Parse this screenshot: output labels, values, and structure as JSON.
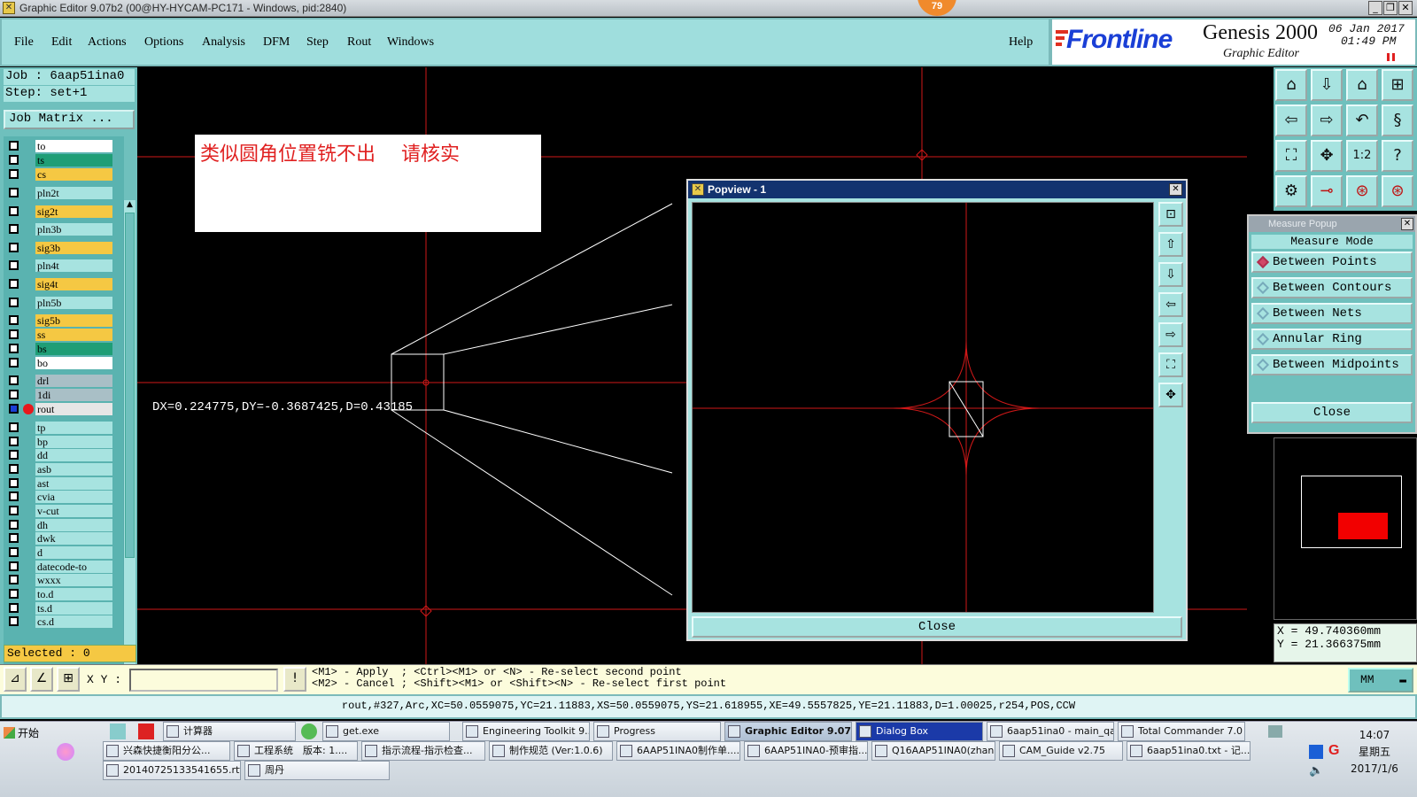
{
  "window": {
    "title": "Graphic Editor 9.07b2 (00@HY-HYCAM-PC171 - Windows, pid:2840)",
    "badge": "79"
  },
  "menu": {
    "items": [
      "File",
      "Edit",
      "Actions",
      "Options",
      "Analysis",
      "DFM",
      "Step",
      "Rout",
      "Windows"
    ],
    "help": "Help"
  },
  "brand": {
    "logo": "Frontline",
    "product": "Genesis 2000",
    "subtitle": "Graphic Editor",
    "date": "06 Jan 2017",
    "time": "01:49 PM",
    "logo_color": "#1a3fd6",
    "accent_color": "#e03020"
  },
  "job": {
    "job_line": "Job : 6aap51ina0",
    "step_line": "Step: set+1",
    "matrix_button": "Job Matrix ..."
  },
  "layers": [
    {
      "name": "to",
      "color": "#ffffff"
    },
    {
      "name": "ts",
      "color": "#1f9e76"
    },
    {
      "name": "cs",
      "color": "#f5c843"
    },
    {
      "name": "pln2t",
      "color": "#a7e3e0"
    },
    {
      "name": "sig2t",
      "color": "#f5c843"
    },
    {
      "name": "pln3b",
      "color": "#a7e3e0"
    },
    {
      "name": "sig3b",
      "color": "#f5c843"
    },
    {
      "name": "pln4t",
      "color": "#a7e3e0"
    },
    {
      "name": "sig4t",
      "color": "#f5c843"
    },
    {
      "name": "pln5b",
      "color": "#a7e3e0"
    },
    {
      "name": "sig5b",
      "color": "#f5c843"
    },
    {
      "name": "ss",
      "color": "#f5c843"
    },
    {
      "name": "bs",
      "color": "#1f9e76"
    },
    {
      "name": "bo",
      "color": "#ffffff"
    },
    {
      "name": "drl",
      "color": "#a9bfc6"
    },
    {
      "name": "1di",
      "color": "#a9bfc6"
    },
    {
      "name": "rout",
      "color": "#e6e6e6"
    },
    {
      "name": "tp",
      "color": "#a7e3e0"
    },
    {
      "name": "bp",
      "color": "#a7e3e0"
    },
    {
      "name": "dd",
      "color": "#a7e3e0"
    },
    {
      "name": "asb",
      "color": "#a7e3e0"
    },
    {
      "name": "ast",
      "color": "#a7e3e0"
    },
    {
      "name": "cvia",
      "color": "#a7e3e0"
    },
    {
      "name": "v-cut",
      "color": "#a7e3e0"
    },
    {
      "name": "dh",
      "color": "#a7e3e0"
    },
    {
      "name": "dwk",
      "color": "#a7e3e0"
    },
    {
      "name": "d",
      "color": "#a7e3e0"
    },
    {
      "name": "datecode-to",
      "color": "#a7e3e0"
    },
    {
      "name": "wxxx",
      "color": "#a7e3e0"
    },
    {
      "name": "to.d",
      "color": "#a7e3e0"
    },
    {
      "name": "ts.d",
      "color": "#a7e3e0"
    },
    {
      "name": "cs.d",
      "color": "#a7e3e0"
    }
  ],
  "selected_text": "Selected : 0",
  "note_text": "类似圆角位置铣不出　 请核实",
  "measure_text": "DX=0.224775,DY=-0.3687425,D=0.43185",
  "popview": {
    "title": "Popview - 1",
    "close_label": "Close"
  },
  "measure_popup": {
    "title": "Measure Popup",
    "header": "Measure Mode",
    "modes": [
      "Between Points",
      "Between Contours",
      "Between Nets",
      "Annular Ring",
      "Between Midpoints"
    ],
    "active_mode": "Between Points",
    "close_label": "Close"
  },
  "coords": {
    "x": "X = 49.740360mm",
    "y": "Y = 21.366375mm"
  },
  "command": {
    "xy_label": "X Y :",
    "xy_value": "",
    "hint_line1": "<M1> - Apply  ; <Ctrl><M1> or <N> - Re-select second point",
    "hint_line2": "<M2> - Cancel ; <Shift><M1> or <Shift><N> - Re-select first point",
    "unit": "MM"
  },
  "status_line": "rout,#327,Arc,XC=50.0559075,YC=21.11883,XS=50.0559075,YS=21.618955,XE=49.5557825,YE=21.11883,D=1.00025,r254,POS,CCW",
  "taskbar": {
    "start": "开始",
    "row1": [
      "计算器",
      "get.exe",
      "Engineering Toolkit 9....",
      "Progress",
      "Graphic Editor 9.07...",
      "Dialog Box",
      "6aap51ina0 - main_qa",
      "Total Commander 7.0 ..."
    ],
    "row2": [
      "兴森快捷衡阳分公...",
      "工程系统　版本: 1....",
      "指示流程-指示检查...",
      "制作规范 (Ver:1.0.6)",
      "6AAP51INA0制作单....",
      "6AAP51INA0-预审指...",
      "Q16AAP51INA0(zhan...",
      "CAM_Guide v2.75",
      "6aap51ina0.txt - 记..."
    ],
    "row3": [
      "20140725133541655.rtf...",
      "周丹"
    ],
    "clock_time": "14:07",
    "clock_day": "星期五",
    "clock_date": "2017/1/6"
  }
}
